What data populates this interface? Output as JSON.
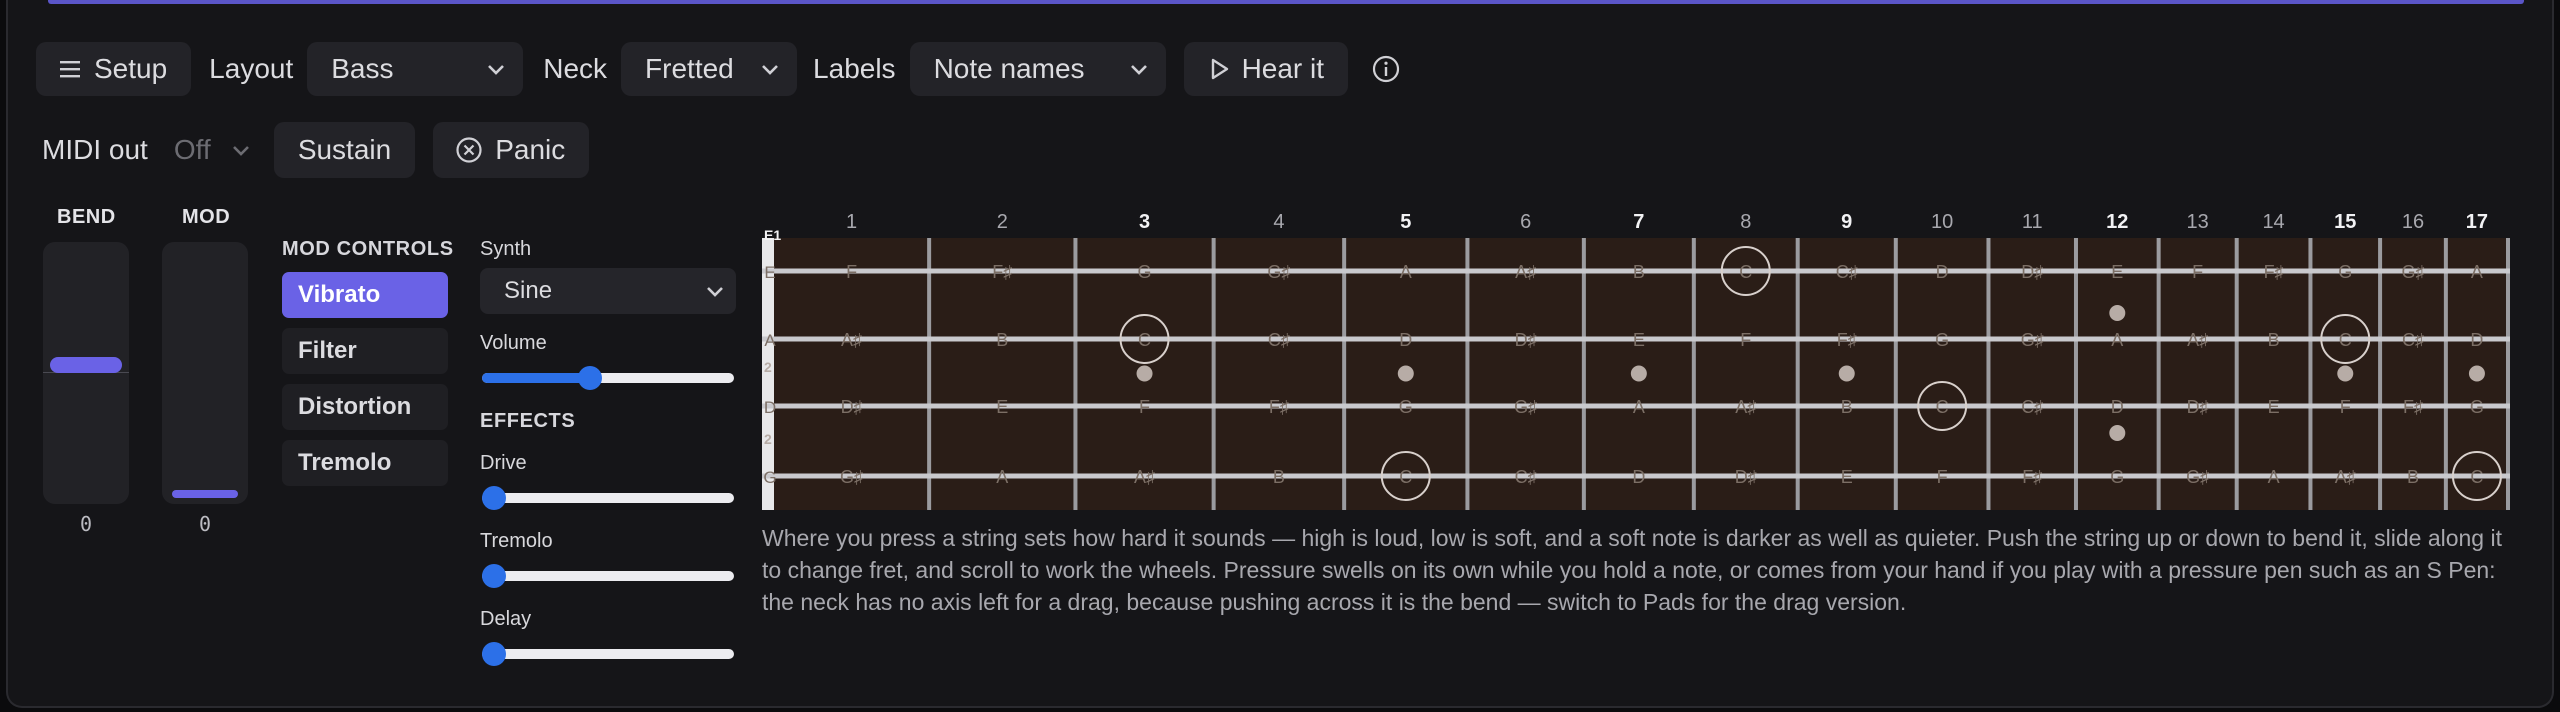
{
  "toolbar": {
    "setup_label": "Setup",
    "layout_label": "Layout",
    "layout_value": "Bass",
    "neck_label": "Neck",
    "neck_value": "Fretted",
    "labels_label": "Labels",
    "labels_value": "Note names",
    "hear_label": "Hear it"
  },
  "midi": {
    "label": "MIDI out",
    "value": "Off",
    "sustain_label": "Sustain",
    "panic_label": "Panic"
  },
  "wheels": {
    "bend_label": "BEND",
    "bend_value": "0",
    "bend_level": 0.5,
    "mod_label": "MOD",
    "mod_value": "0",
    "mod_level": 0.0
  },
  "mod_controls": {
    "title": "MOD CONTROLS",
    "items": [
      {
        "label": "Vibrato",
        "active": true
      },
      {
        "label": "Filter",
        "active": false
      },
      {
        "label": "Distortion",
        "active": false
      },
      {
        "label": "Tremolo",
        "active": false
      }
    ]
  },
  "synth": {
    "label": "Synth",
    "value": "Sine",
    "volume_label": "Volume",
    "volume_level": 0.43,
    "effects_title": "EFFECTS",
    "drive_label": "Drive",
    "drive_level": 0.0,
    "tremolo_label": "Tremolo",
    "tremolo_level": 0.0,
    "delay_label": "Delay",
    "delay_level": 0.0
  },
  "fretboard": {
    "open_label": "E1",
    "fret_numbers": [
      "1",
      "2",
      "3",
      "4",
      "5",
      "6",
      "7",
      "8",
      "9",
      "10",
      "11",
      "12",
      "13",
      "14",
      "15",
      "16",
      "17"
    ],
    "bold_frets": [
      "3",
      "5",
      "7",
      "9",
      "12",
      "15",
      "17"
    ],
    "strings": [
      {
        "open": "E",
        "notes": [
          "F",
          "F♯",
          "G",
          "G♯",
          "A",
          "A♯",
          "B",
          "C",
          "C♯",
          "D",
          "D♯",
          "E",
          "F",
          "F♯",
          "G",
          "G♯",
          "A"
        ]
      },
      {
        "open": "A",
        "notes": [
          "A♯",
          "B",
          "C",
          "C♯",
          "D",
          "D♯",
          "E",
          "F",
          "F♯",
          "G",
          "G♯",
          "A",
          "A♯",
          "B",
          "C",
          "C♯",
          "D"
        ]
      },
      {
        "open": "D",
        "notes": [
          "D♯",
          "E",
          "F",
          "F♯",
          "G",
          "G♯",
          "A",
          "A♯",
          "B",
          "C",
          "C♯",
          "D",
          "D♯",
          "E",
          "F",
          "F♯",
          "G"
        ]
      },
      {
        "open": "G",
        "notes": [
          "G♯",
          "A",
          "A♯",
          "B",
          "C",
          "C♯",
          "D",
          "D♯",
          "E",
          "F",
          "F♯",
          "G",
          "G♯",
          "A",
          "A♯",
          "B",
          "C"
        ]
      }
    ],
    "side_numbers": [
      "2",
      "2"
    ],
    "circled_note": "C",
    "colors": {
      "wood": "#2a1d17",
      "fret": "#9b9b9f",
      "string": "#c9c9cd",
      "label": "#7c6f66",
      "inlay": "#b7aca6"
    }
  },
  "description": "Where you press a string sets how hard it sounds — high is loud, low is soft, and a soft note is darker as well as quieter. Push the string up or down to bend it, slide along it to change fret, and scroll to work the wheels. Pressure swells on its own while you hold a note, or comes from your hand if you play with a pressure pen such as an S Pen: the neck has no axis left for a drag, because pushing across it is the bend — switch to Pads for the drag version.",
  "accent": "#6a62e6"
}
